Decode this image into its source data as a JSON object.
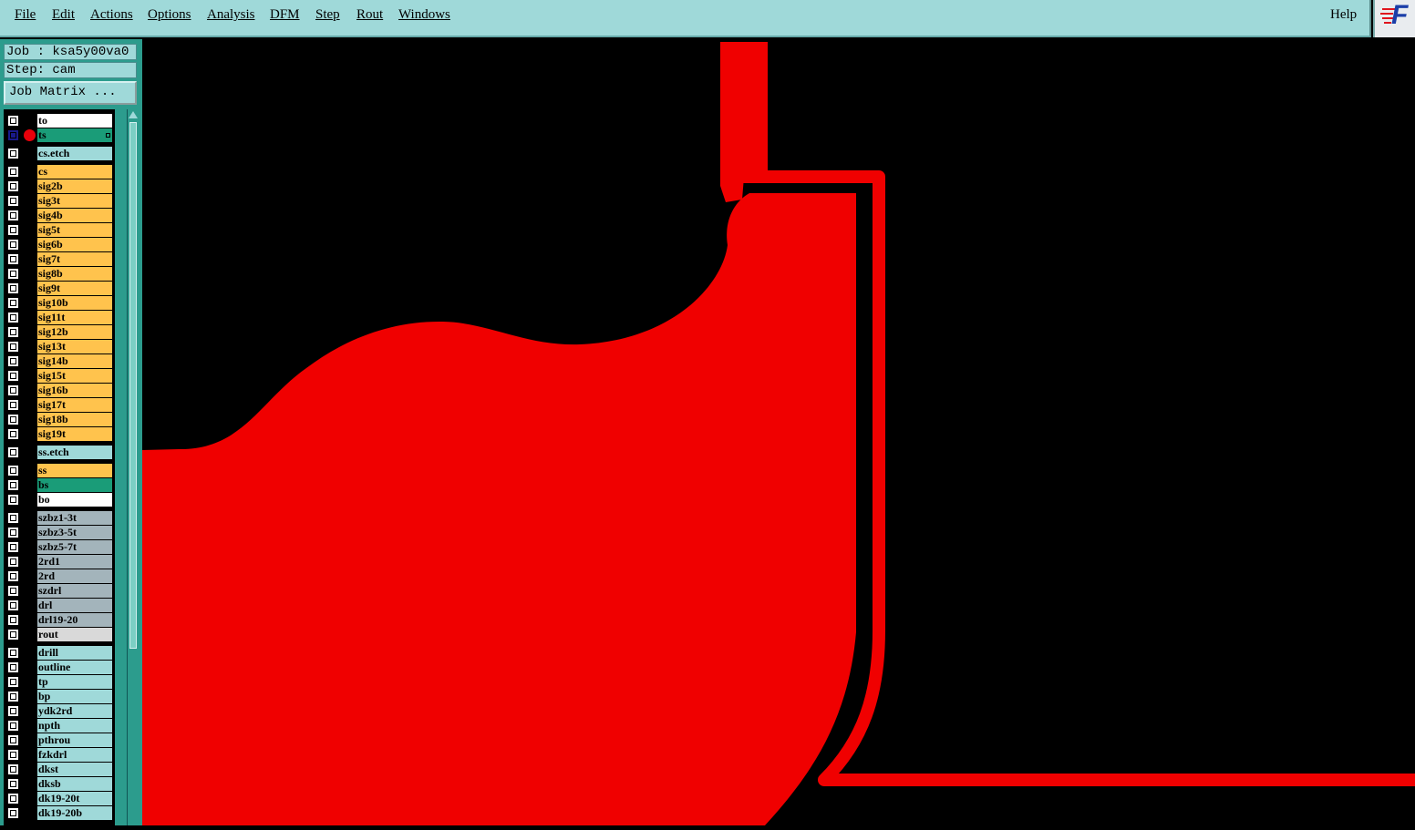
{
  "menu": {
    "items": [
      "File",
      "Edit",
      "Actions",
      "Options",
      "Analysis",
      "DFM",
      "Step",
      "Rout",
      "Windows"
    ],
    "help": "Help"
  },
  "logo": {
    "letter": "F",
    "name": "logo-icon"
  },
  "sidebar": {
    "job_label": "Job : ksa5y00va0",
    "step_label": "Step: cam",
    "job_matrix_label": "Job Matrix ..."
  },
  "colors": {
    "copper": "#f00000",
    "signal_layer": "#ffc34d",
    "board_layer": "#9fd9d9",
    "drill_layer": "#a3b4bb",
    "solder_layer": "#1a9c78",
    "background": "#000000"
  },
  "layers": [
    {
      "name": "to",
      "color": "#ffffff"
    },
    {
      "name": "ts",
      "color": "#1a9c78",
      "active": true
    },
    {
      "name": "cs.etch",
      "color": "#9fd9d9"
    },
    {
      "name": "cs",
      "color": "#ffc34d"
    },
    {
      "name": "sig2b",
      "color": "#ffc34d"
    },
    {
      "name": "sig3t",
      "color": "#ffc34d"
    },
    {
      "name": "sig4b",
      "color": "#ffc34d"
    },
    {
      "name": "sig5t",
      "color": "#ffc34d"
    },
    {
      "name": "sig6b",
      "color": "#ffc34d"
    },
    {
      "name": "sig7t",
      "color": "#ffc34d"
    },
    {
      "name": "sig8b",
      "color": "#ffc34d"
    },
    {
      "name": "sig9t",
      "color": "#ffc34d"
    },
    {
      "name": "sig10b",
      "color": "#ffc34d"
    },
    {
      "name": "sig11t",
      "color": "#ffc34d"
    },
    {
      "name": "sig12b",
      "color": "#ffc34d"
    },
    {
      "name": "sig13t",
      "color": "#ffc34d"
    },
    {
      "name": "sig14b",
      "color": "#ffc34d"
    },
    {
      "name": "sig15t",
      "color": "#ffc34d"
    },
    {
      "name": "sig16b",
      "color": "#ffc34d"
    },
    {
      "name": "sig17t",
      "color": "#ffc34d"
    },
    {
      "name": "sig18b",
      "color": "#ffc34d"
    },
    {
      "name": "sig19t",
      "color": "#ffc34d"
    },
    {
      "name": "ss.etch",
      "color": "#9fd9d9"
    },
    {
      "name": "ss",
      "color": "#ffc34d"
    },
    {
      "name": "bs",
      "color": "#1a9c78"
    },
    {
      "name": "bo",
      "color": "#ffffff"
    },
    {
      "name": "szbz1-3t",
      "color": "#a3b4bb"
    },
    {
      "name": "szbz3-5t",
      "color": "#a3b4bb"
    },
    {
      "name": "szbz5-7t",
      "color": "#a3b4bb"
    },
    {
      "name": "2rd1",
      "color": "#a3b4bb"
    },
    {
      "name": "2rd",
      "color": "#a3b4bb"
    },
    {
      "name": "szdrl",
      "color": "#a3b4bb"
    },
    {
      "name": "drl",
      "color": "#a3b4bb"
    },
    {
      "name": "drl19-20",
      "color": "#a3b4bb"
    },
    {
      "name": "rout",
      "color": "#d9d9d9"
    },
    {
      "name": "drill",
      "color": "#9fd9d9"
    },
    {
      "name": "outline",
      "color": "#9fd9d9"
    },
    {
      "name": "tp",
      "color": "#9fd9d9"
    },
    {
      "name": "bp",
      "color": "#9fd9d9"
    },
    {
      "name": "ydk2rd",
      "color": "#9fd9d9"
    },
    {
      "name": "npth",
      "color": "#9fd9d9"
    },
    {
      "name": "pthrou",
      "color": "#9fd9d9"
    },
    {
      "name": "fzkdrl",
      "color": "#9fd9d9"
    },
    {
      "name": "dkst",
      "color": "#9fd9d9"
    },
    {
      "name": "dksb",
      "color": "#9fd9d9"
    },
    {
      "name": "dk19-20t",
      "color": "#9fd9d9"
    },
    {
      "name": "dk19-20b",
      "color": "#9fd9d9"
    }
  ]
}
